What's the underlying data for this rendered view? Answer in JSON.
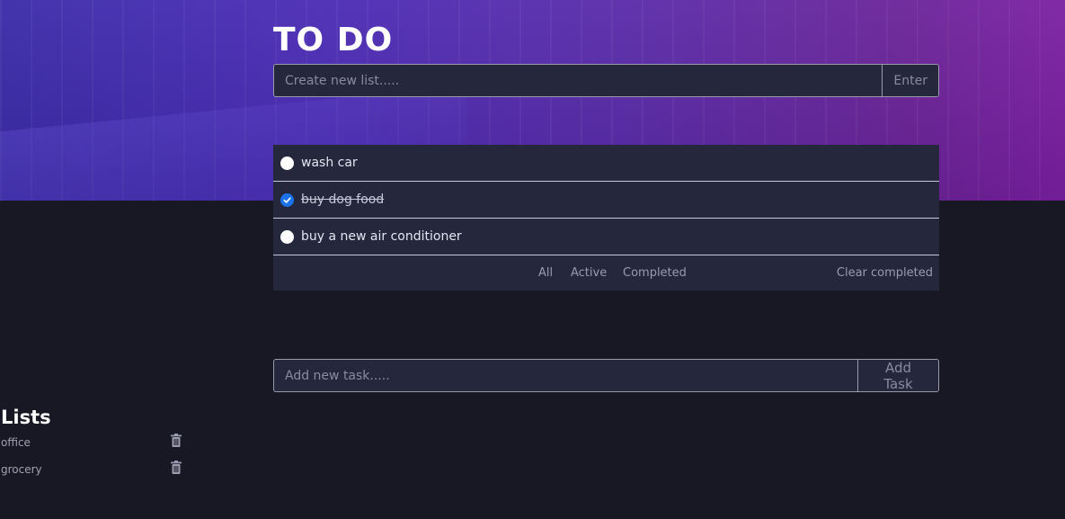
{
  "header": {
    "title": "TO DO"
  },
  "list_input": {
    "placeholder": "Create new list.....",
    "button_label": "Enter"
  },
  "todos": [
    {
      "text": "wash car",
      "completed": false
    },
    {
      "text": "buy dog food",
      "completed": true
    },
    {
      "text": "buy a new air conditioner",
      "completed": false
    }
  ],
  "filters": {
    "all": "All",
    "active": "Active",
    "completed": "Completed",
    "clear": "Clear completed"
  },
  "task_input": {
    "placeholder": "Add new task.....",
    "button_label": "Add Task"
  },
  "sidebar": {
    "title": "Lists",
    "lists": [
      {
        "name": "office",
        "icon": "trash-icon"
      },
      {
        "name": "grocery",
        "icon": "trash-icon"
      }
    ]
  },
  "colors": {
    "accent": "#1a73e8",
    "panel": "#25273c",
    "background": "#181824"
  }
}
